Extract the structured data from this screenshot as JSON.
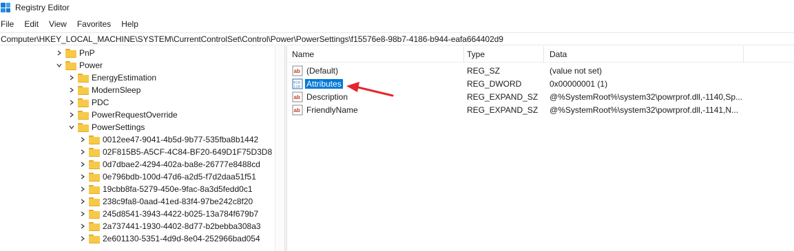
{
  "window": {
    "title": "Registry Editor",
    "app_icon": "registry-editor-icon"
  },
  "menu": {
    "items": [
      "File",
      "Edit",
      "View",
      "Favorites",
      "Help"
    ]
  },
  "address": {
    "path": "Computer\\HKEY_LOCAL_MACHINE\\SYSTEM\\CurrentControlSet\\Control\\Power\\PowerSettings\\f15576e8-98b7-4186-b944-eafa664402d9"
  },
  "tree": {
    "nodes": [
      {
        "label": "PnP",
        "expanded": false
      },
      {
        "label": "Power",
        "expanded": true
      },
      {
        "label": "EnergyEstimation",
        "expanded": false
      },
      {
        "label": "ModernSleep",
        "expanded": false
      },
      {
        "label": "PDC",
        "expanded": false
      },
      {
        "label": "PowerRequestOverride",
        "expanded": false
      },
      {
        "label": "PowerSettings",
        "expanded": true
      },
      {
        "label": "0012ee47-9041-4b5d-9b77-535fba8b1442",
        "expanded": false
      },
      {
        "label": "02F815B5-A5CF-4C84-BF20-649D1F75D3D8",
        "expanded": false
      },
      {
        "label": "0d7dbae2-4294-402a-ba8e-26777e8488cd",
        "expanded": false
      },
      {
        "label": "0e796bdb-100d-47d6-a2d5-f7d2daa51f51",
        "expanded": false
      },
      {
        "label": "19cbb8fa-5279-450e-9fac-8a3d5fedd0c1",
        "expanded": false
      },
      {
        "label": "238c9fa8-0aad-41ed-83f4-97be242c8f20",
        "expanded": false
      },
      {
        "label": "245d8541-3943-4422-b025-13a784f679b7",
        "expanded": false
      },
      {
        "label": "2a737441-1930-4402-8d77-b2bebba308a3",
        "expanded": false
      },
      {
        "label": "2e601130-5351-4d9d-8e04-252966bad054",
        "expanded": false
      }
    ]
  },
  "list": {
    "columns": {
      "name": "Name",
      "type": "Type",
      "data": "Data"
    },
    "rows": [
      {
        "name": "(Default)",
        "type": "REG_SZ",
        "data": "(value not set)",
        "icon": "string-value-icon",
        "selected": false
      },
      {
        "name": "Attributes",
        "type": "REG_DWORD",
        "data": "0x00000001 (1)",
        "icon": "binary-value-icon",
        "selected": true
      },
      {
        "name": "Description",
        "type": "REG_EXPAND_SZ",
        "data": "@%SystemRoot%\\system32\\powrprof.dll,-1140,Sp...",
        "icon": "string-value-icon",
        "selected": false
      },
      {
        "name": "FriendlyName",
        "type": "REG_EXPAND_SZ",
        "data": "@%SystemRoot%\\system32\\powrprof.dll,-1141,N...",
        "icon": "string-value-icon",
        "selected": false
      }
    ]
  },
  "annotation": {
    "arrow_color": "#e3262b",
    "points_to": "Attributes"
  },
  "colors": {
    "selection": "#0078d7",
    "folder": "#f7c948"
  }
}
